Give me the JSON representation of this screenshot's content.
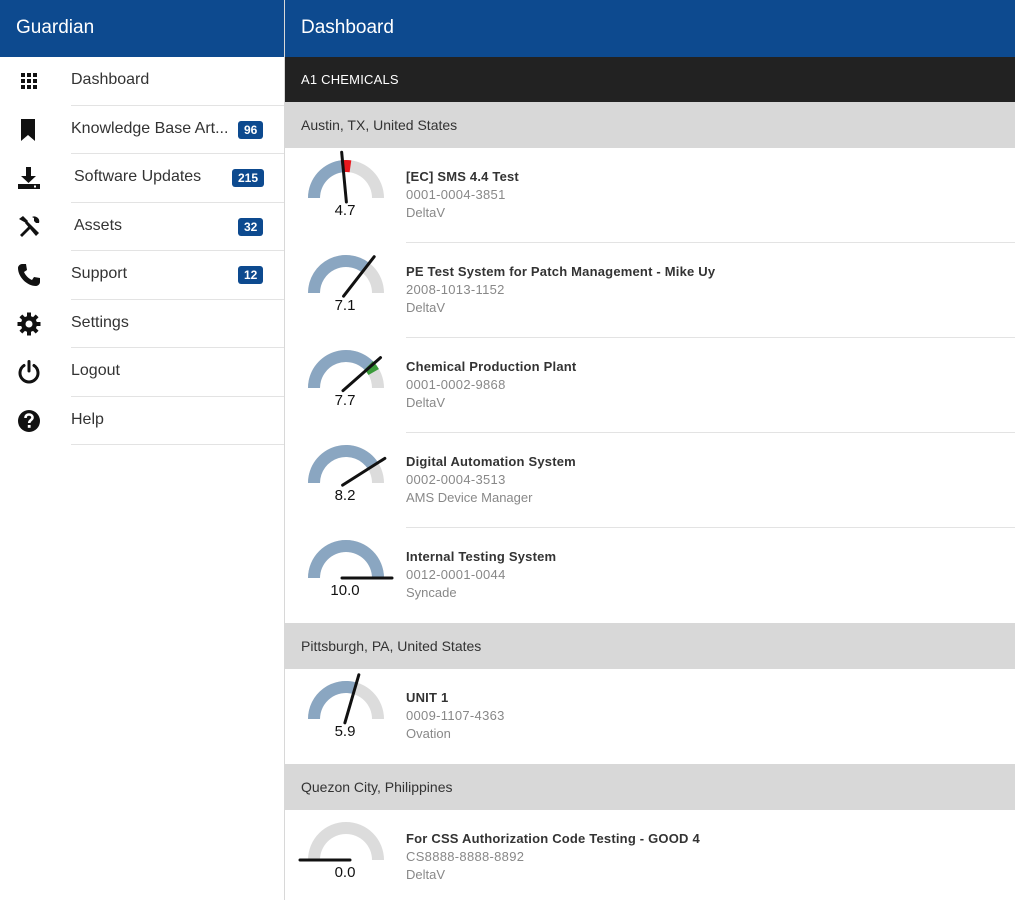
{
  "sidebar": {
    "title": "Guardian",
    "items": [
      {
        "label": "Dashboard",
        "icon": "grid-icon",
        "badge": null
      },
      {
        "label": "Knowledge Base Art...",
        "icon": "bookmark-icon",
        "badge": "96"
      },
      {
        "label": "Software Updates",
        "icon": "download-icon",
        "badge": "215"
      },
      {
        "label": "Assets",
        "icon": "tools-icon",
        "badge": "32"
      },
      {
        "label": "Support",
        "icon": "phone-icon",
        "badge": "12"
      },
      {
        "label": "Settings",
        "icon": "gear-icon",
        "badge": null
      },
      {
        "label": "Logout",
        "icon": "power-icon",
        "badge": null
      },
      {
        "label": "Help",
        "icon": "question-icon",
        "badge": null
      }
    ]
  },
  "main": {
    "title": "Dashboard",
    "company": "A1 CHEMICALS",
    "locations": [
      {
        "name": "Austin, TX, United States",
        "systems": [
          {
            "score": "4.7",
            "value": 4.7,
            "name": "[EC] SMS 4.4 Test",
            "id": "0001-0004-3851",
            "platform": "DeltaV"
          },
          {
            "score": "7.1",
            "value": 7.1,
            "name": "PE Test System for Patch Management - Mike Uy",
            "id": "2008-1013-1152",
            "platform": "DeltaV"
          },
          {
            "score": "7.7",
            "value": 7.7,
            "name": "Chemical Production Plant",
            "id": "0001-0002-9868",
            "platform": "DeltaV"
          },
          {
            "score": "8.2",
            "value": 8.2,
            "name": "Digital Automation System",
            "id": "0002-0004-3513",
            "platform": "AMS Device Manager"
          },
          {
            "score": "10.0",
            "value": 10.0,
            "name": "Internal Testing System",
            "id": "0012-0001-0044",
            "platform": "Syncade"
          }
        ]
      },
      {
        "name": "Pittsburgh, PA, United States",
        "systems": [
          {
            "score": "5.9",
            "value": 5.9,
            "name": "UNIT 1",
            "id": "0009-1107-4363",
            "platform": "Ovation"
          }
        ]
      },
      {
        "name": "Quezon City, Philippines",
        "systems": [
          {
            "score": "0.0",
            "value": 0.0,
            "name": "For CSS Authorization Code Testing - GOOD 4",
            "id": "CS8888-8888-8892",
            "platform": "DeltaV"
          }
        ]
      }
    ]
  },
  "colors": {
    "header": "#0d4a8f",
    "company_bar": "#222222",
    "location_bar": "#d8d8d8",
    "gauge_fill": "#8aa6c1",
    "gauge_track": "#dcdcdc",
    "gauge_red": "#e8181e",
    "gauge_green": "#3a9a3a"
  }
}
